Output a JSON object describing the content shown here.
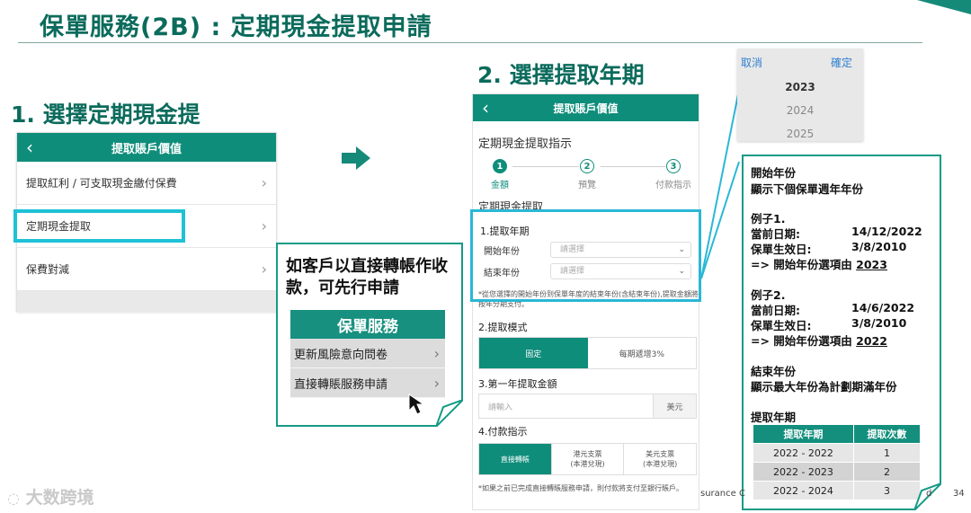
{
  "header": {
    "title": "保單服務(2B) : 定期現金提取申請"
  },
  "step1": {
    "heading": "1. 選擇定期現金提",
    "nav_title": "提取賬戶價值",
    "back_icon": "chevron-left-icon",
    "menu": [
      {
        "label": "提取紅利 / 可支取現金繳付保費"
      },
      {
        "label": "定期現金提取"
      },
      {
        "label": "保費對減"
      }
    ]
  },
  "callout": {
    "text": "如客戶以直接轉帳作收款，可先行申請",
    "menu_title": "保單服務",
    "menu": [
      {
        "label": "更新風險意向問卷"
      },
      {
        "label": "直接轉賬服務申請"
      }
    ]
  },
  "step2": {
    "heading": "2. 選擇提取年期",
    "nav_title": "提取賬戶價值",
    "section_title": "定期現金提取指示",
    "steps": [
      {
        "num": "1",
        "label": "金額"
      },
      {
        "num": "2",
        "label": "預覽"
      },
      {
        "num": "3",
        "label": "付款指示"
      }
    ],
    "subsection": "定期現金提取",
    "period_title": "1.提取年期",
    "start_label": "開始年份",
    "end_label": "結束年份",
    "select_placeholder": "請選擇",
    "period_note": "*從您選擇的開始年份到保單年度的結束年份(含結束年份),提取金額將按年分期支付。",
    "mode_title": "2.提取模式",
    "mode_options": [
      "固定",
      "每期遞增3%"
    ],
    "amount_title": "3.第一年提取金額",
    "amount_placeholder": "請輸入",
    "amount_unit": "美元",
    "pay_title": "4.付款指示",
    "pay_options": [
      "直接轉帳",
      "港元支票\n(本港兌現)",
      "美元支票\n(本港兌現)"
    ],
    "pay_note": "*如果之前已完成直接轉賬服務申請，則付款將支付至銀行賬戶。"
  },
  "picker": {
    "cancel": "取消",
    "confirm": "確定",
    "years": [
      "2023",
      "2024",
      "2025"
    ]
  },
  "info": {
    "start_title": "開始年份",
    "start_desc": "顯示下個保單週年年份",
    "ex1_title": "例子1.",
    "ex1_date_label": "當前日期:",
    "ex1_date": "14/12/2022",
    "ex1_eff_label": "保單生效日:",
    "ex1_eff": "3/8/2010",
    "ex1_result_prefix": "=> 開始年份選項由 ",
    "ex1_result_year": "2023",
    "ex2_title": "例子2.",
    "ex2_date_label": "當前日期:",
    "ex2_date": "14/6/2022",
    "ex2_eff_label": "保單生效日:",
    "ex2_eff": "3/8/2010",
    "ex2_result_prefix": "=> 開始年份選項由 ",
    "ex2_result_year": "2022",
    "end_title": "結束年份",
    "end_desc": "顯示最大年份為計劃期滿年份",
    "period_title": "提取年期",
    "table_headers": [
      "提取年期",
      "提取次數"
    ],
    "table_rows": [
      [
        "2022 - 2022",
        "1"
      ],
      [
        "2022 - 2023",
        "2"
      ],
      [
        "2022 - 2024",
        "3"
      ]
    ]
  },
  "footer": {
    "watermark": "大数跨境",
    "left_text": "surance C",
    "right_text": "d",
    "page_number": "34"
  },
  "colors": {
    "brand_teal": "#0f8d7b",
    "highlight_cyan": "#1fc1d6",
    "title_teal": "#0b6b5c"
  }
}
